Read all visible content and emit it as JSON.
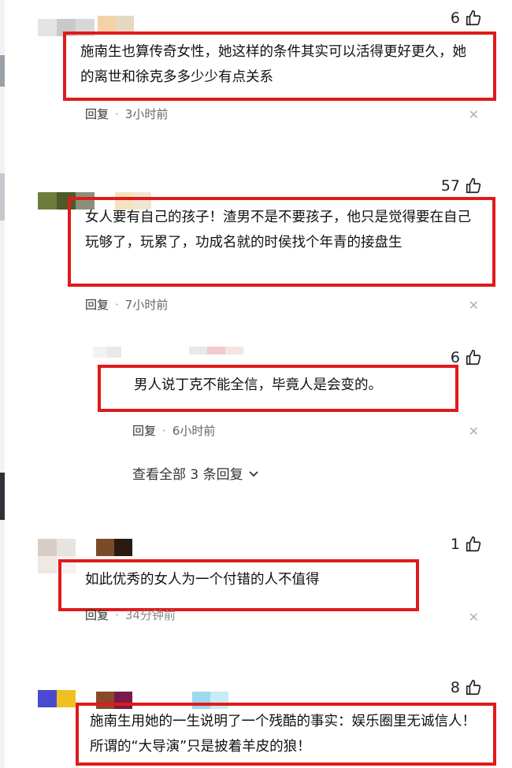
{
  "comments": [
    {
      "likes": "6",
      "text": "施南生也算传奇女性，她这样的条件其实可以活得更好更久，她的离世和徐克多多少少有点关系",
      "reply_label": "回复",
      "sep": "·",
      "time": "3小时前"
    },
    {
      "likes": "57",
      "text": "女人要有自己的孩子！渣男不是不要孩子，他只是觉得要在自己玩够了，玩累了，功成名就的时侯找个年青的接盘生",
      "reply_label": "回复",
      "sep": "·",
      "time": "7小时前"
    },
    {
      "likes": "1",
      "text": "如此优秀的女人为一个付错的人不值得",
      "reply_label": "回复",
      "sep": "·",
      "time": "34分钟前"
    },
    {
      "likes": "8",
      "text": "施南生用她的一生说明了一个残酷的事实：娱乐圈里无诚信人！所谓的“大导演”只是披着羊皮的狼！",
      "reply_label": "",
      "sep": "",
      "time": ""
    }
  ],
  "sub_reply": {
    "likes": "6",
    "text": "男人说丁克不能全信，毕竟人是会变的。",
    "reply_label": "回复",
    "sep": "·",
    "time": "6小时前"
  },
  "view_all": "查看全部 3 条回复",
  "colors": {
    "highlight_border": "#e01a1a",
    "meta_text": "#666666"
  },
  "icons": {
    "like": "thumbs-up-icon",
    "close": "close-icon",
    "expand": "chevron-down-icon"
  }
}
